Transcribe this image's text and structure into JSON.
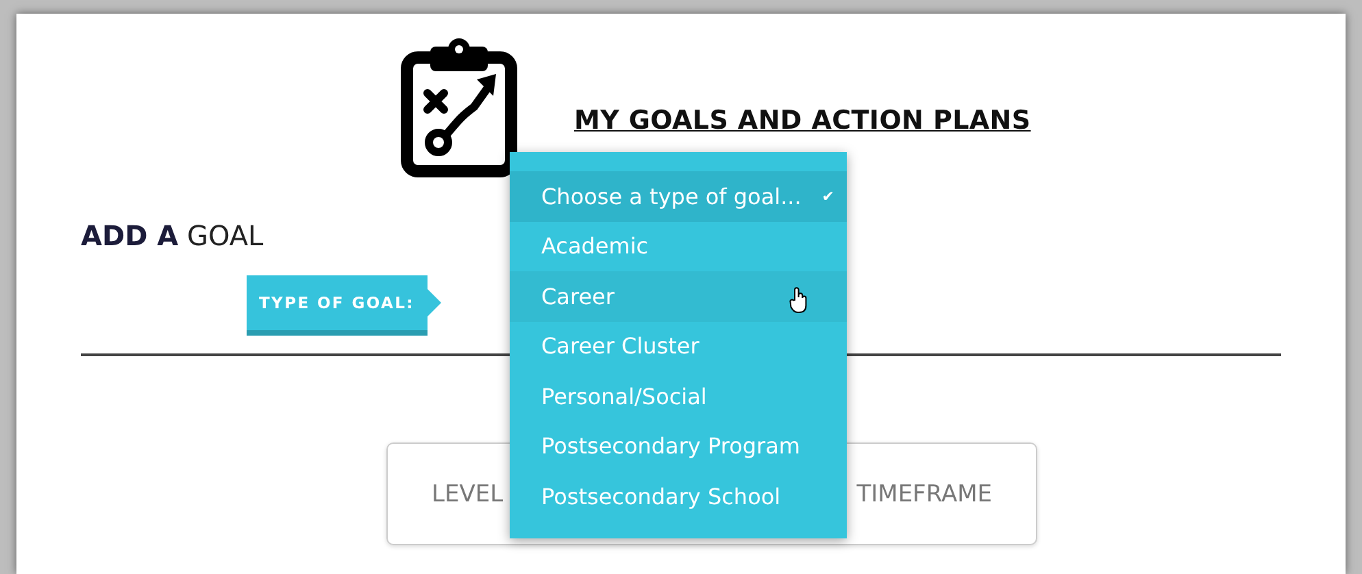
{
  "header": {
    "title": "MY GOALS AND ACTION PLANS"
  },
  "dropdown_check": "✔",
  "section": {
    "title_bold": "ADD A",
    "title_rest": "GOAL"
  },
  "type_label": "TYPE OF GOAL:",
  "dropdown": {
    "options": [
      {
        "label": "Choose a type of goal...",
        "selected": true,
        "hovered": false
      },
      {
        "label": "Academic",
        "selected": false,
        "hovered": false
      },
      {
        "label": "Career",
        "selected": false,
        "hovered": true
      },
      {
        "label": "Career Cluster",
        "selected": false,
        "hovered": false
      },
      {
        "label": "Personal/Social",
        "selected": false,
        "hovered": false
      },
      {
        "label": "Postsecondary Program",
        "selected": false,
        "hovered": false
      },
      {
        "label": "Postsecondary School",
        "selected": false,
        "hovered": false
      }
    ]
  },
  "options_box": {
    "items": [
      "LEVEL",
      "TIMEFRAME"
    ]
  }
}
